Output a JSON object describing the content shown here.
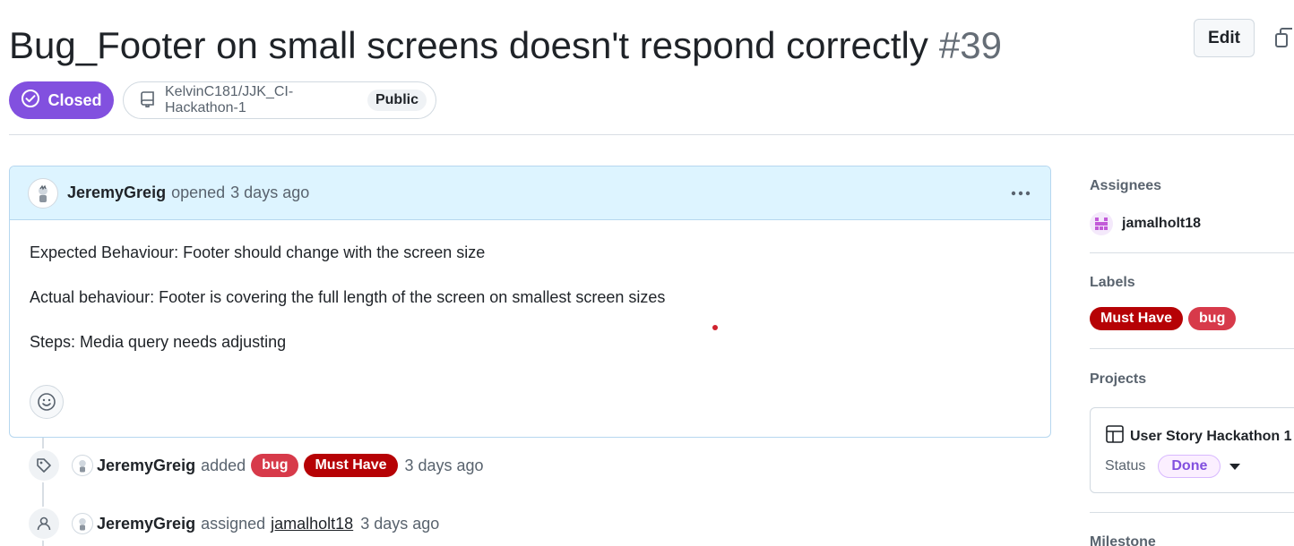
{
  "issue": {
    "title": "Bug_Footer on small screens doesn't respond correctly",
    "number": "#39",
    "state": "Closed",
    "repo": "KelvinC181/JJK_CI-Hackathon-1",
    "visibility": "Public",
    "edit_label": "Edit"
  },
  "comment": {
    "author": "JeremyGreig",
    "action": "opened",
    "time": "3 days ago",
    "menu_icon": "kebab-horizontal-icon",
    "lines": [
      "Expected Behaviour: Footer should change with the screen size",
      "Actual behaviour: Footer is covering the full length of the screen on smallest screen sizes",
      "Steps: Media query needs adjusting"
    ]
  },
  "timeline": [
    {
      "icon": "tag-icon",
      "author": "JeremyGreig",
      "action": "added",
      "labels": [
        "bug",
        "Must Have"
      ],
      "time": "3 days ago"
    },
    {
      "icon": "person-icon",
      "author": "JeremyGreig",
      "action": "assigned",
      "target": "jamalholt18",
      "time": "3 days ago"
    }
  ],
  "sidebar": {
    "assignees_heading": "Assignees",
    "assignee": "jamalholt18",
    "labels_heading": "Labels",
    "labels": [
      "Must Have",
      "bug"
    ],
    "projects_heading": "Projects",
    "project_name": "User Story Hackathon 1",
    "status_label": "Status",
    "status_value": "Done",
    "milestone_heading": "Milestone"
  },
  "colors": {
    "closed_purple": "#8250df",
    "label_bug": "#d73a4a",
    "label_must_have": "#b60205",
    "comment_header_bg": "#ddf4ff"
  }
}
